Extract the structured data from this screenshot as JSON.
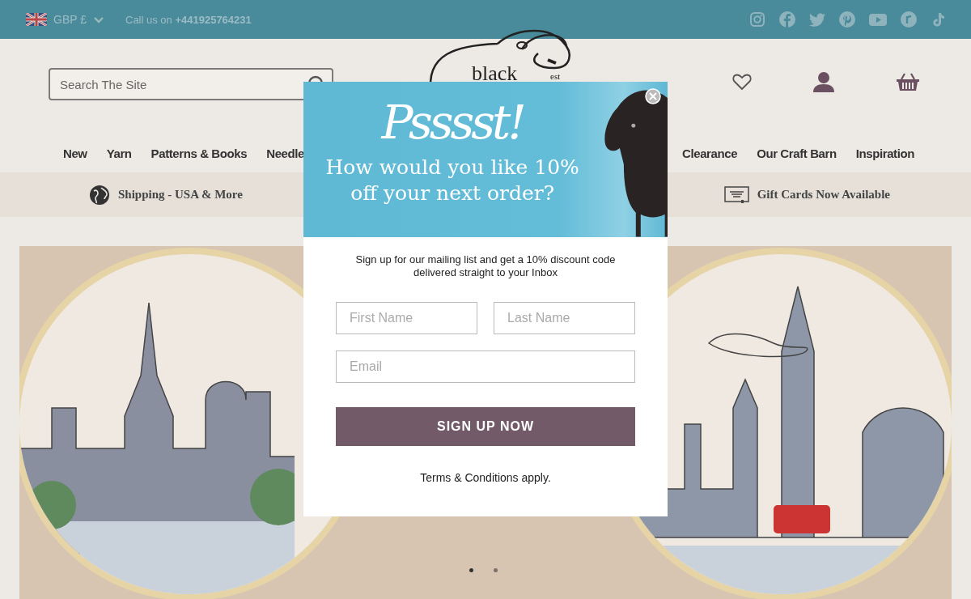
{
  "top_bar": {
    "currency": "GBP £",
    "call_label": "Call us on",
    "phone": "+441925764231",
    "social": [
      {
        "kind": "instagram"
      },
      {
        "kind": "facebook"
      },
      {
        "kind": "twitter"
      },
      {
        "kind": "pinterest"
      },
      {
        "kind": "youtube"
      },
      {
        "kind": "ravelry"
      },
      {
        "kind": "tiktok"
      }
    ]
  },
  "header": {
    "search": {
      "placeholder": "Search The Site"
    },
    "logo": {
      "word": "black",
      "est": "est"
    }
  },
  "nav": {
    "left": [
      "New",
      "Yarn",
      "Patterns & Books",
      "Needle"
    ],
    "right": [
      "Clearance",
      "Our Craft Barn",
      "Inspiration"
    ]
  },
  "info_bar": [
    {
      "kind": "globe",
      "text": "Shipping - USA & More"
    },
    {
      "kind": "gift",
      "text": "Gift Cards Now Available"
    }
  ],
  "carousel": {
    "dots": [
      {
        "selected": true
      },
      {
        "selected": false
      }
    ]
  },
  "popup": {
    "headline": "Psssst!",
    "subhead": "How would you like 10% off your next order?",
    "intro": "Sign up for our mailing list and get a 10% discount code delivered straight to your Inbox",
    "fields": [
      {
        "placeholder": "First Name"
      },
      {
        "placeholder": "Last Name"
      },
      {
        "placeholder": "Email"
      }
    ],
    "button": "SIGN UP NOW",
    "terms": "Terms & Conditions apply."
  }
}
